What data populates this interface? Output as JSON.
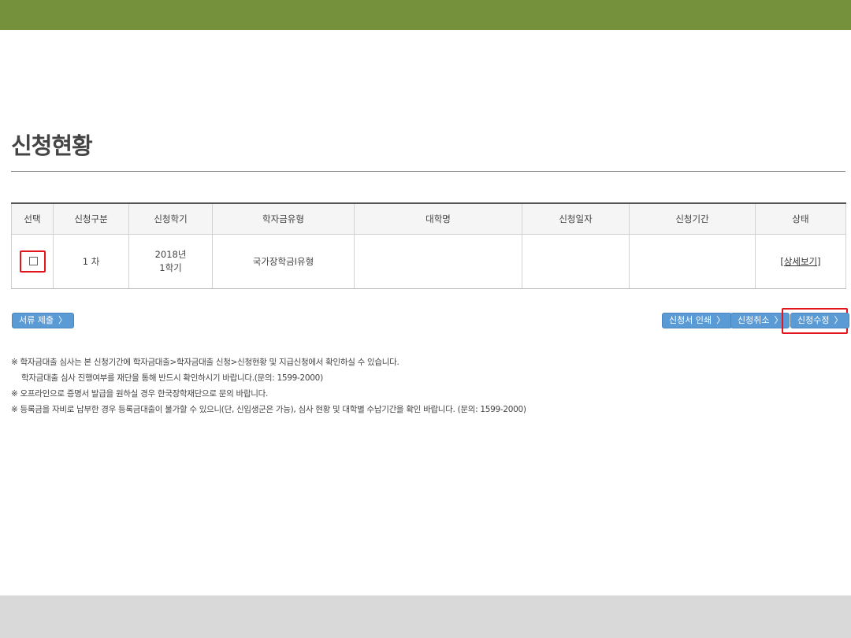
{
  "page": {
    "title": "신청현황"
  },
  "table": {
    "headers": [
      "선택",
      "신청구분",
      "신청학기",
      "학자금유형",
      "대학명",
      "신청일자",
      "신청기간",
      "상태"
    ],
    "rows": [
      {
        "category": "1 차",
        "semester_line1": "2018년",
        "semester_line2": "1학기",
        "loan_type": "국가장학금I유형",
        "university": "",
        "apply_date": "",
        "apply_period": "",
        "status_link": "[상세보기]"
      }
    ]
  },
  "buttons": {
    "submit_docs": "서류 제출",
    "print_application": "신청서 인쇄",
    "cancel_application": "신청취소",
    "modify_application": "신청수정",
    "chevron": "〉"
  },
  "notes": [
    "※ 학자금대출 심사는 본 신청기간에 학자금대출>학자금대출 신청>신청현황 및 지급신청에서 확인하실 수 있습니다.",
    "학자금대출 심사 진행여부를 재단을 통해 반드시 확인하시기 바랍니다.(문의: 1599-2000)",
    "※ 오프라인으로 증명서 발급을 원하실 경우 한국장학재단으로 문의 바랍니다.",
    "※ 등록금을 자비로 납부한 경우 등록금대출이 불가할 수 있으니(단, 신입생군은 가능), 심사 현황 및 대학별 수납기간을 확인 바랍니다. (문의: 1599-2000)"
  ],
  "colors": {
    "top_bar": "#75913c",
    "button": "#5b9bd5",
    "highlight": "#e3141b",
    "bottom_bar": "#d9d9d9"
  }
}
